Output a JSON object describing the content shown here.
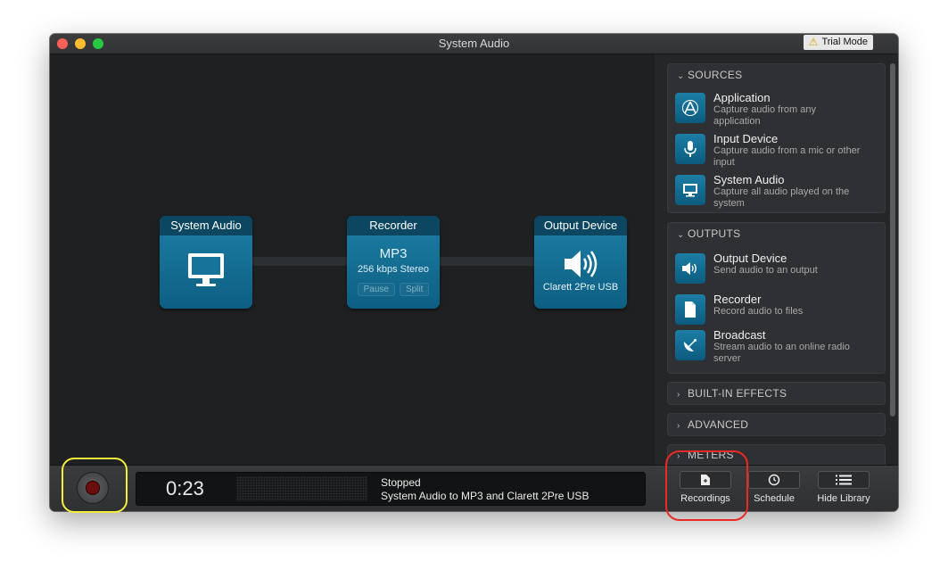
{
  "window": {
    "title": "System Audio",
    "trial_badge": "Trial Mode"
  },
  "canvas": {
    "nodes": {
      "source": {
        "header": "System Audio",
        "icon": "monitor-icon"
      },
      "recorder": {
        "header": "Recorder",
        "format": "MP3",
        "quality": "256 kbps Stereo",
        "pause_label": "Pause",
        "split_label": "Split"
      },
      "output": {
        "header": "Output Device",
        "icon": "speaker-icon",
        "device": "Clarett 2Pre USB"
      }
    }
  },
  "sidebar": {
    "sources": {
      "heading": "SOURCES",
      "items": [
        {
          "title": "Application",
          "desc": "Capture audio from any application",
          "icon": "app-store-icon"
        },
        {
          "title": "Input Device",
          "desc": "Capture audio from a mic or other input",
          "icon": "microphone-icon"
        },
        {
          "title": "System Audio",
          "desc": "Capture all audio played on the system",
          "icon": "monitor-icon"
        }
      ]
    },
    "outputs": {
      "heading": "OUTPUTS",
      "items": [
        {
          "title": "Output Device",
          "desc": "Send audio to an output",
          "icon": "speaker-icon"
        },
        {
          "title": "Recorder",
          "desc": "Record audio to files",
          "icon": "document-icon"
        },
        {
          "title": "Broadcast",
          "desc": "Stream audio to an online radio server",
          "icon": "satellite-dish-icon"
        }
      ]
    },
    "builtin_effects": {
      "heading": "BUILT-IN EFFECTS"
    },
    "advanced": {
      "heading": "ADVANCED"
    },
    "meters": {
      "heading": "METERS"
    }
  },
  "bottombar": {
    "timer": "0:23",
    "status": "Stopped",
    "description": "System Audio to MP3 and Clarett 2Pre USB",
    "recordings_label": "Recordings",
    "schedule_label": "Schedule",
    "hide_library_label": "Hide Library"
  },
  "colors": {
    "highlight_yellow": "#f4ef3c",
    "highlight_red": "#ea2b23",
    "node_blue": "#1d7fa6"
  }
}
